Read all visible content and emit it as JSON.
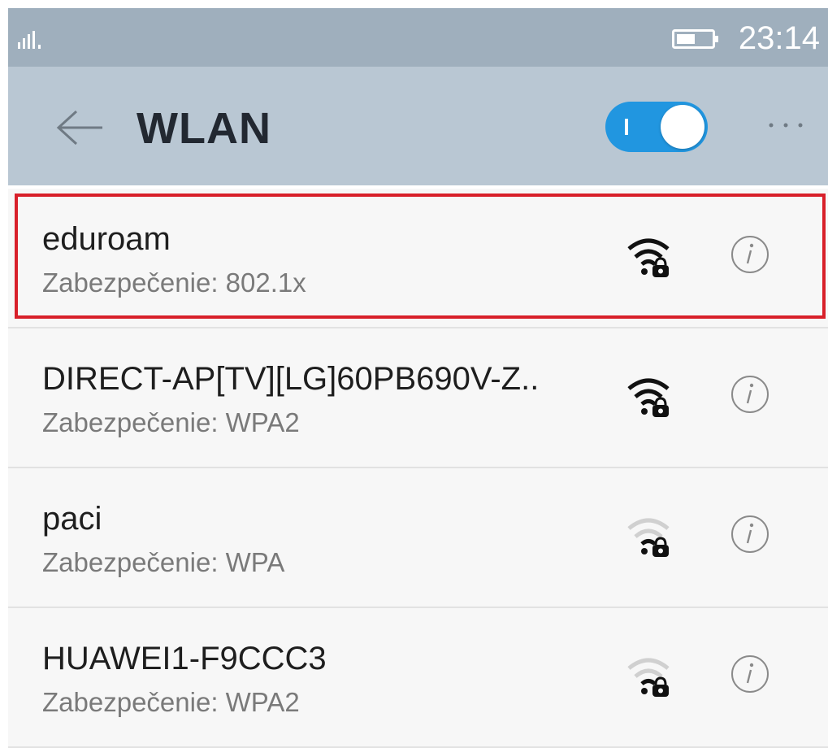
{
  "status_bar": {
    "time": "23:14",
    "signal_icon": "signal-bars-icon",
    "battery_icon": "battery-icon"
  },
  "app_bar": {
    "title": "WLAN",
    "back_icon": "back-arrow-icon",
    "toggle_on": true,
    "more_icon": "more-options-icon"
  },
  "colors": {
    "toggle": "#2196e0",
    "highlight": "#d8202a",
    "app_bar": "#b9c7d3",
    "status_bar": "#9fafbd"
  },
  "networks": [
    {
      "name": "eduroam",
      "security": "Zabezpečenie: 802.1x",
      "signal": "strong",
      "highlighted": true
    },
    {
      "name": "DIRECT-AP[TV][LG]60PB690V-Z..",
      "security": "Zabezpečenie: WPA2",
      "signal": "strong",
      "highlighted": false
    },
    {
      "name": "paci",
      "security": "Zabezpečenie: WPA",
      "signal": "weak",
      "highlighted": false
    },
    {
      "name": "HUAWEI1-F9CCC3",
      "security": "Zabezpečenie: WPA2",
      "signal": "weak",
      "highlighted": false
    }
  ]
}
